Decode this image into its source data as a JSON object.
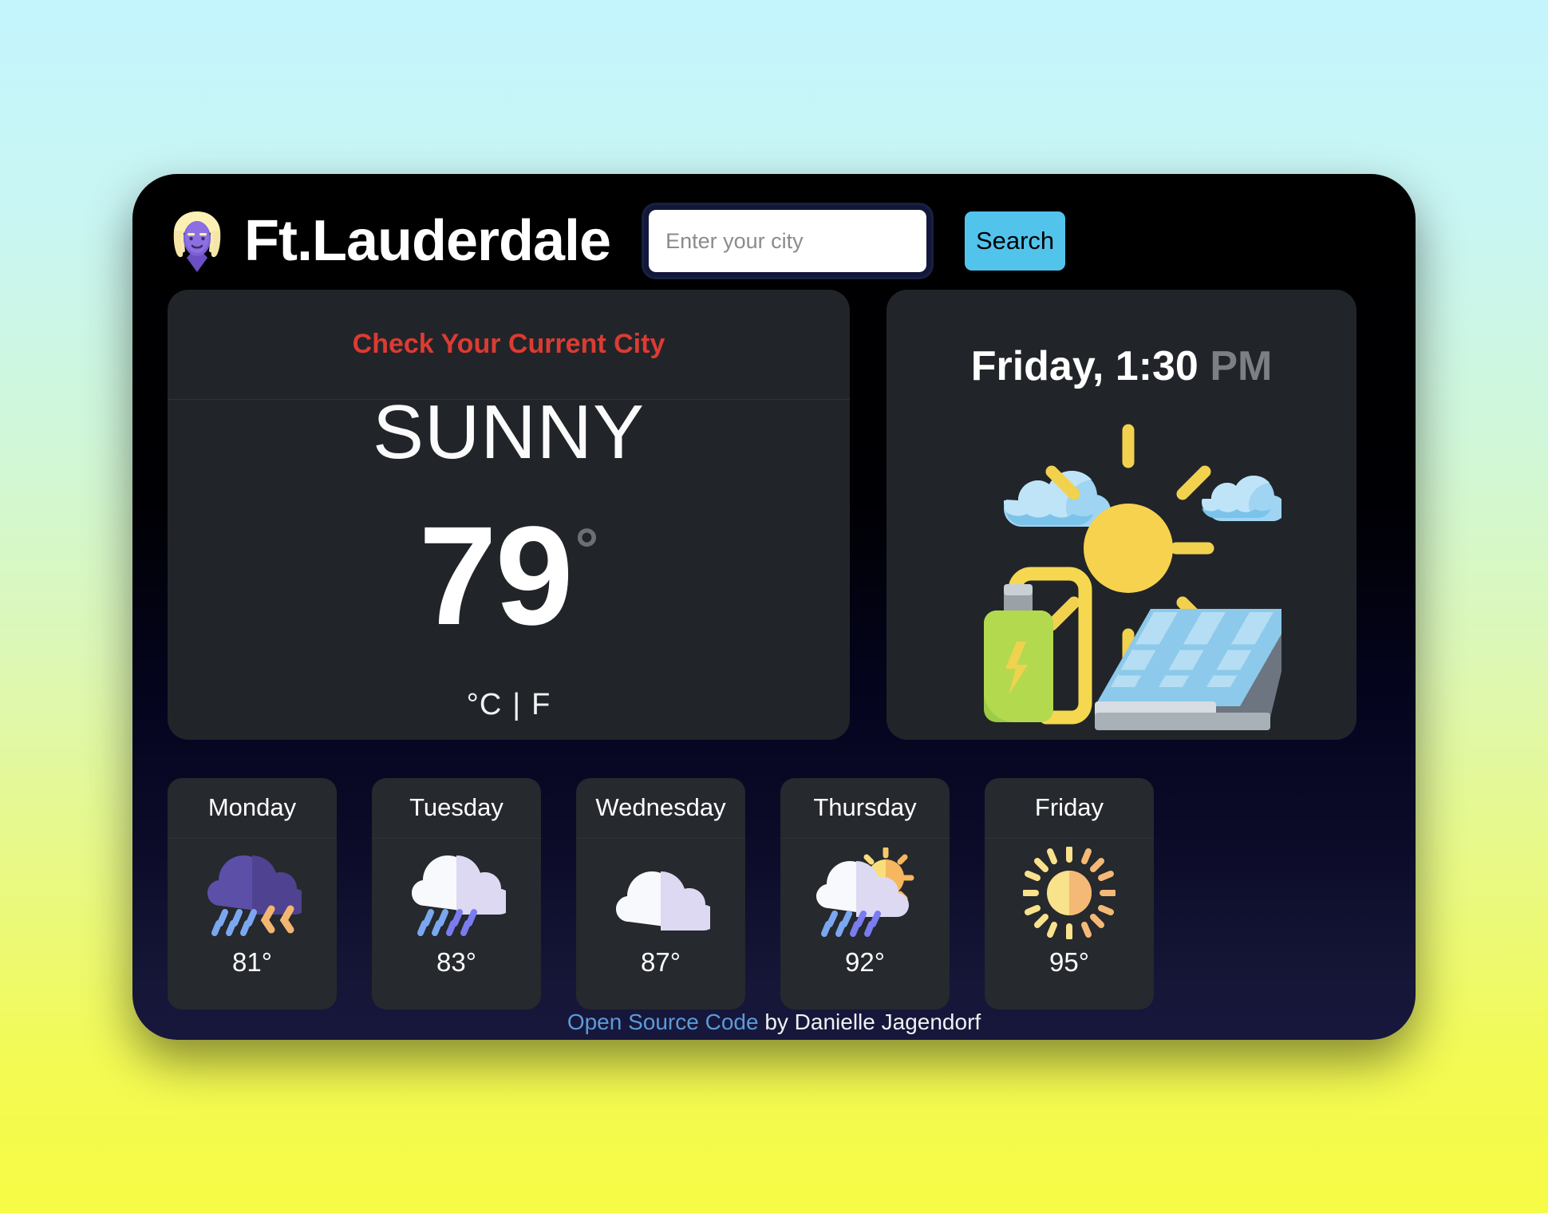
{
  "header": {
    "avatar_icon": "blonde-woman-emoji",
    "app_title": "Ft.Lauderdale",
    "search_placeholder": "Enter your city",
    "search_value": "",
    "search_button_label": "Search"
  },
  "current_panel": {
    "prompt": "Check Your Current City",
    "condition": "SUNNY",
    "temperature": "79",
    "degree_symbol": "°",
    "unit_celsius": "°C",
    "unit_separator": "|",
    "unit_fahrenheit": "F"
  },
  "now_panel": {
    "day_time": "Friday, 1:30",
    "meridiem": "PM",
    "illustration_icon": "solar-panel-battery-sun-illustration"
  },
  "forecast": {
    "days": [
      {
        "name": "Monday",
        "temp": "81°",
        "icon": "thunderstorm-rain-cloud-icon"
      },
      {
        "name": "Tuesday",
        "temp": "83°",
        "icon": "rain-cloud-icon"
      },
      {
        "name": "Wednesday",
        "temp": "87°",
        "icon": "cloud-icon"
      },
      {
        "name": "Thursday",
        "temp": "92°",
        "icon": "sun-behind-rain-cloud-icon"
      },
      {
        "name": "Friday",
        "temp": "95°",
        "icon": "sun-icon"
      }
    ]
  },
  "footer": {
    "link_label": "Open Source Code",
    "attribution": " by Danielle Jagendorf"
  },
  "colors": {
    "accent_blue": "#52c4ec",
    "alert_red": "#dc3b33",
    "link_blue": "#5b9bd8",
    "card_bg": "#26292d",
    "panel_bg": "#212529",
    "page_gradient_top": "#c4f5fd",
    "page_gradient_bottom": "#f6fb44"
  }
}
